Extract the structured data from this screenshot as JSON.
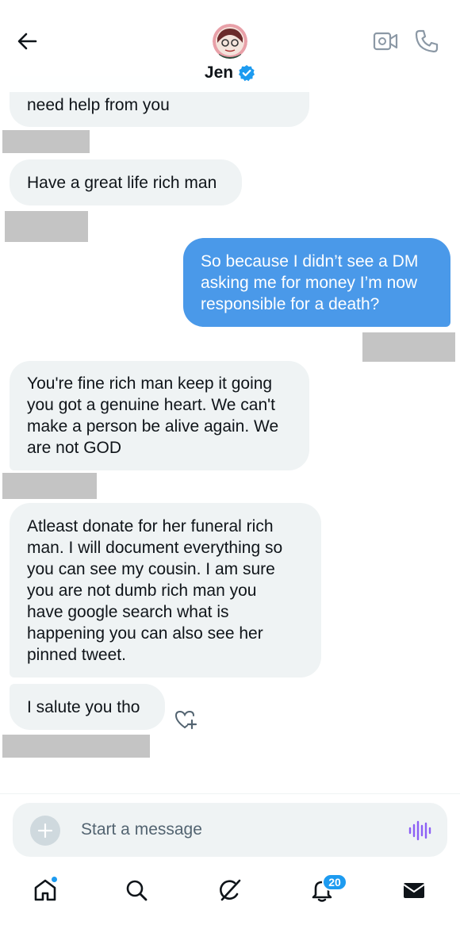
{
  "header": {
    "title": "Jen",
    "back_icon": "arrow-left-icon",
    "verified_icon": "verified-badge-icon",
    "video_icon": "video-camera-icon",
    "call_icon": "phone-icon"
  },
  "messages": [
    {
      "direction": "in",
      "text": "need help from you"
    },
    {
      "direction": "in",
      "text": "Have a great life rich man"
    },
    {
      "direction": "out",
      "lines": [
        "So because I didn’t see a DM",
        "asking me for money I’m now",
        "responsible for a death?"
      ]
    },
    {
      "direction": "in",
      "lines": [
        "You're fine rich man keep it going",
        "you got a genuine heart. We can't",
        "make a person be alive again. We",
        "are not GOD"
      ]
    },
    {
      "direction": "in",
      "lines": [
        "Atleast donate for her funeral rich",
        "man. I will document everything so",
        "you can see my cousin. I am sure",
        "you are not dumb rich man you",
        "have google search what is",
        "happening you can also see her",
        "pinned tweet."
      ]
    },
    {
      "direction": "in",
      "text": "I salute you tho"
    }
  ],
  "composer": {
    "placeholder": "Start a message",
    "plus_icon": "plus-icon",
    "voice_icon": "voice-waveform-icon"
  },
  "nav": {
    "items": [
      "home-icon",
      "search-icon",
      "grok-icon",
      "notifications-bell-icon",
      "messages-envelope-icon"
    ],
    "notifications_badge": "20"
  },
  "colors": {
    "incoming_bubble": "#eff3f4",
    "outgoing_bubble": "#4a99e9",
    "accent": "#1d9bf0",
    "redaction": "#c4c4c4"
  }
}
